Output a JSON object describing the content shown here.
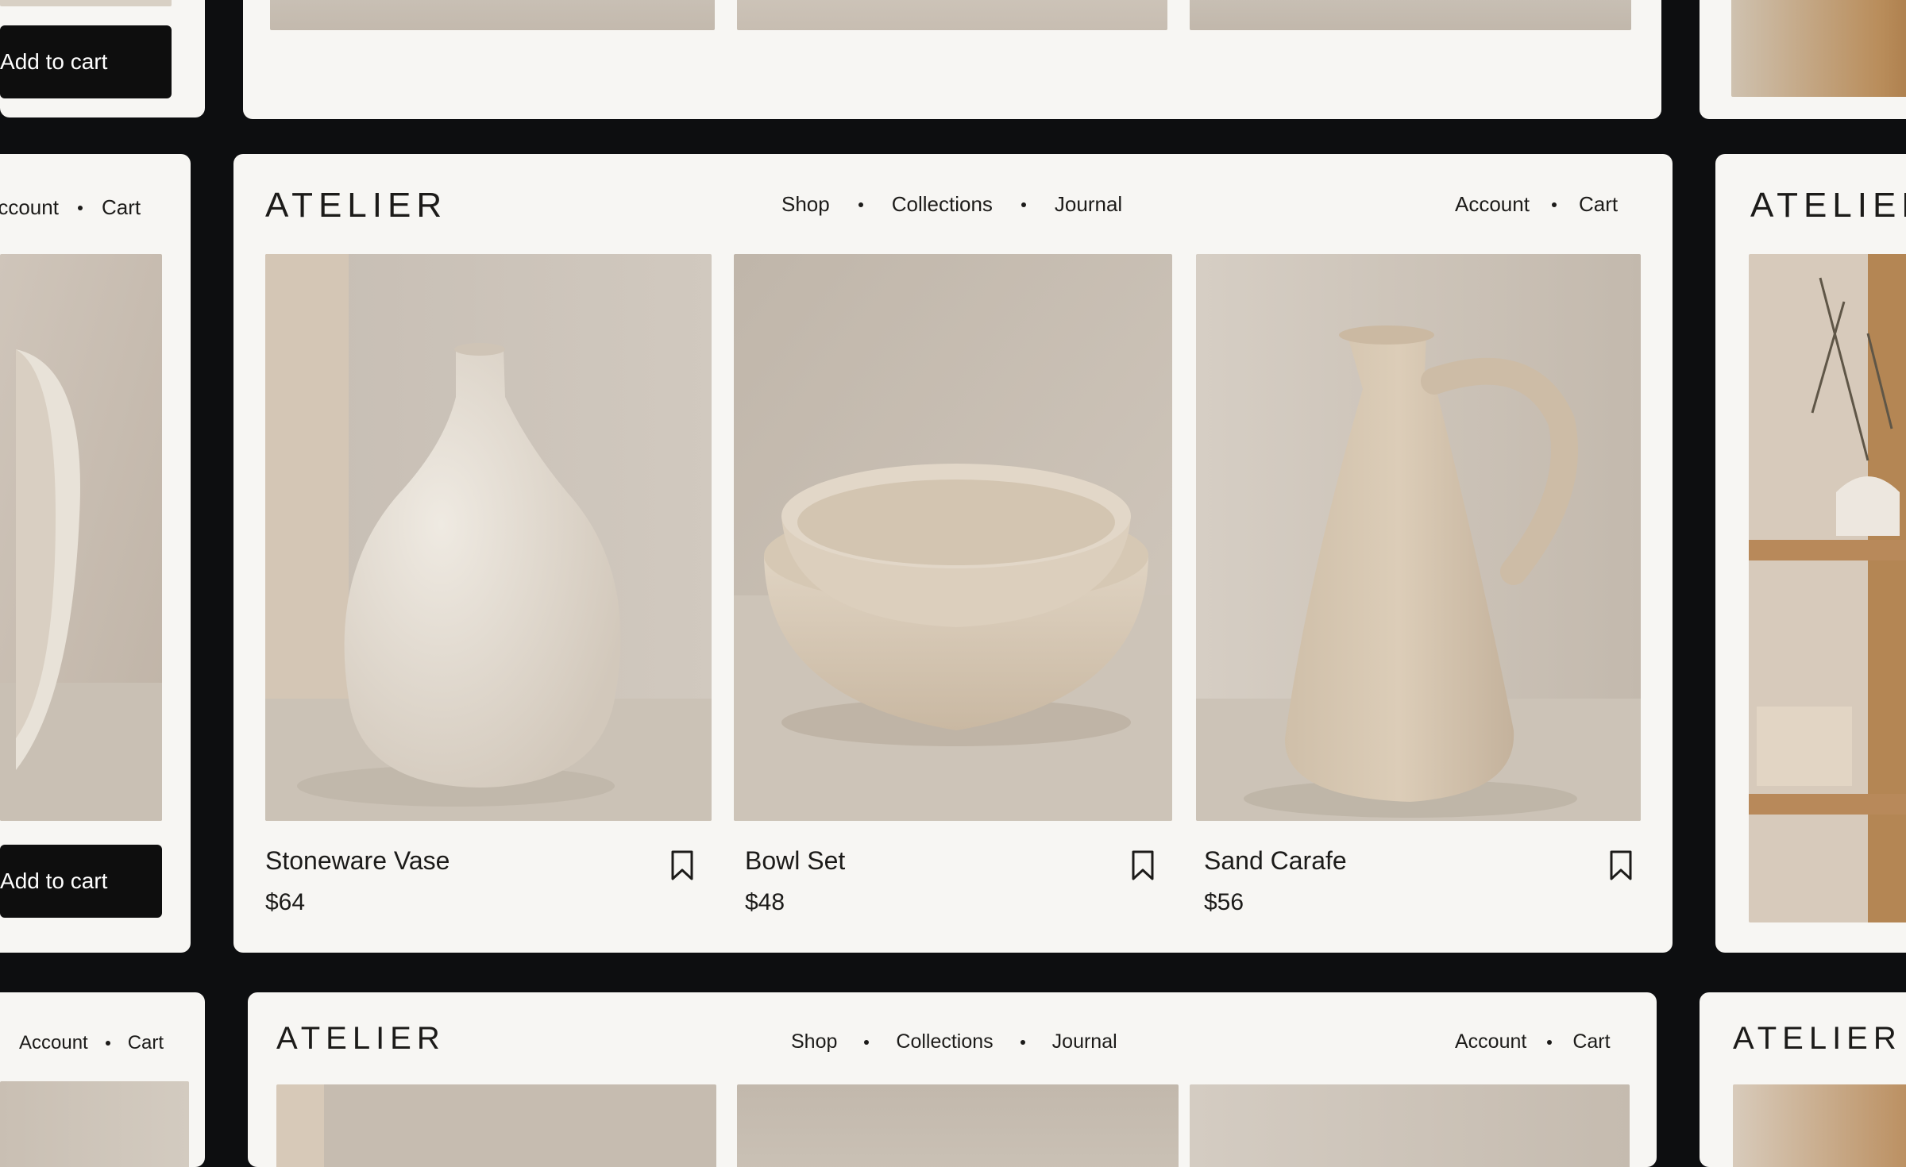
{
  "brand": "ATELIER",
  "nav": {
    "shop": "Shop",
    "collections": "Collections",
    "journal": "Journal",
    "account": "Account",
    "cart": "Cart"
  },
  "cta_label": "Add to cart",
  "add_to_cart_partial": "dd to cart",
  "account_partial": "ccount",
  "brand_partial": "ATELIER",
  "products": [
    {
      "title": "Stoneware Vase",
      "price": "$64",
      "icon": "bookmark-icon"
    },
    {
      "title": "Bowl Set",
      "price": "$48",
      "icon": "bookmark-icon"
    },
    {
      "title": "Sand Carafe",
      "price": "$56",
      "icon": "bookmark-icon"
    }
  ],
  "colors": {
    "background": "#0d0e10",
    "card": "#f7f6f3",
    "text": "#1c1b19",
    "button": "#0e0e0e",
    "photo_warm": "#cfc4b7",
    "ceramic": "#e3dbd0"
  }
}
